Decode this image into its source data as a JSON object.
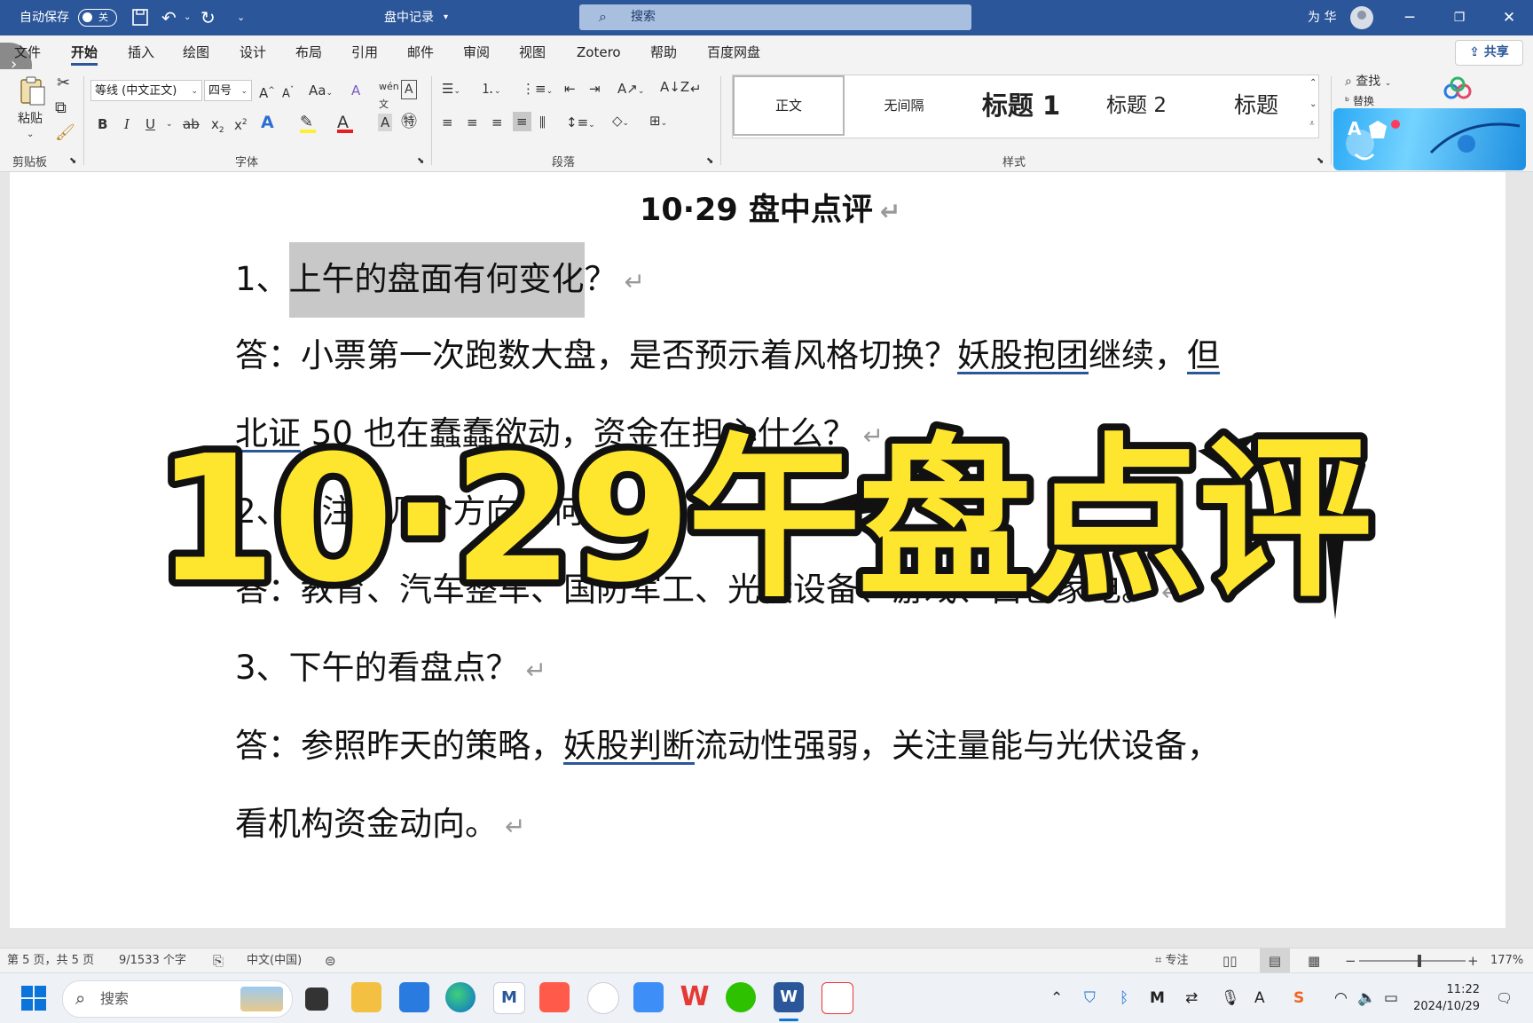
{
  "titlebar": {
    "autosave_label": "自动保存",
    "autosave_state": "关",
    "doc_title": "盘中记录",
    "search_placeholder": "搜索",
    "user_name": "为 华"
  },
  "menu": {
    "tabs": [
      "文件",
      "开始",
      "插入",
      "绘图",
      "设计",
      "布局",
      "引用",
      "邮件",
      "审阅",
      "视图",
      "Zotero",
      "帮助",
      "百度网盘"
    ],
    "active_tab": "开始",
    "share_label": "共享"
  },
  "ribbon": {
    "clipboard": {
      "paste_label": "粘贴",
      "group_label": "剪贴板"
    },
    "font": {
      "font_name": "等线 (中文正文)",
      "font_size": "四号",
      "group_label": "字体"
    },
    "paragraph": {
      "group_label": "段落"
    },
    "styles": {
      "items": [
        "正文",
        "无间隔",
        "标题 1",
        "标题 2",
        "标题"
      ],
      "group_label": "样式"
    },
    "editing": {
      "find_label": "查找",
      "replace_label": "替换"
    }
  },
  "document": {
    "title": "10·29 盘中点评",
    "q1_prefix": "1、",
    "q1_highlight": "上午的盘面有何变化",
    "q1_suffix": "？",
    "a1_line1_a": "答：小票第一次跑数大盘，是否预示着风格切换？",
    "a1_line1_ul": "妖股抱团",
    "a1_line1_b": "继续，",
    "a1_line1_ul2": "但",
    "a1_line2_ul": "北证",
    "a1_line2_b": " 50 也在蠢蠢欲动，资金在担心什么？",
    "q2": "2、关注的几个方向如何？",
    "a2": "答：教育、汽车整车、国防军工、光伏设备、游戏、白色家电。",
    "q3": "3、下午的看盘点？",
    "a3_line1_a": "答：参照昨天的策略，",
    "a3_line1_ul": "妖股判断",
    "a3_line1_b": "流动性强弱，关注量能与光伏设备，",
    "a3_line2": "看机构资金动向。"
  },
  "overlay": {
    "text": "10·29午盘点评"
  },
  "statusbar": {
    "page": "第 5 页，共 5 页",
    "words": "9/1533 个字",
    "language": "中文(中国)",
    "focus_label": "专注",
    "zoom": "177%"
  },
  "taskbar": {
    "search_placeholder": "搜索",
    "time": "11:22",
    "date": "2024/10/29"
  },
  "colors": {
    "word_blue": "#2b579a",
    "overlay_yellow": "#ffe62e",
    "selection_gray": "#c8c8c8"
  }
}
